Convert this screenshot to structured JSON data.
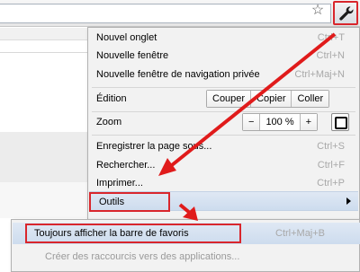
{
  "menu": {
    "items": [
      {
        "label": "Nouvel onglet",
        "shortcut": "Ctrl+T"
      },
      {
        "label": "Nouvelle fenêtre",
        "shortcut": "Ctrl+N"
      },
      {
        "label": "Nouvelle fenêtre de navigation privée",
        "shortcut": "Ctrl+Maj+N"
      }
    ],
    "edit": {
      "label": "Édition",
      "cut": "Couper",
      "copy": "Copier",
      "paste": "Coller"
    },
    "zoom": {
      "label": "Zoom",
      "minus": "−",
      "value": "100 %",
      "plus": "+"
    },
    "items2": [
      {
        "label": "Enregistrer la page sous...",
        "shortcut": "Ctrl+S"
      },
      {
        "label": "Rechercher...",
        "shortcut": "Ctrl+F"
      },
      {
        "label": "Imprimer...",
        "shortcut": "Ctrl+P"
      }
    ],
    "tools": {
      "label": "Outils"
    }
  },
  "submenu": {
    "items": [
      {
        "label": "Toujours afficher la barre de favoris",
        "shortcut": "Ctrl+Maj+B"
      },
      {
        "label": "Créer des raccourcis vers des applications..."
      }
    ]
  },
  "icons": {
    "bookmark": "star-icon",
    "wrench": "wrench-icon",
    "fullscreen": "fullscreen-icon",
    "submenu": "chevron-right-icon"
  },
  "colors": {
    "highlight_border": "#d9262c",
    "arrow": "#e01b1b",
    "hover_row": "#d6e2f2"
  }
}
